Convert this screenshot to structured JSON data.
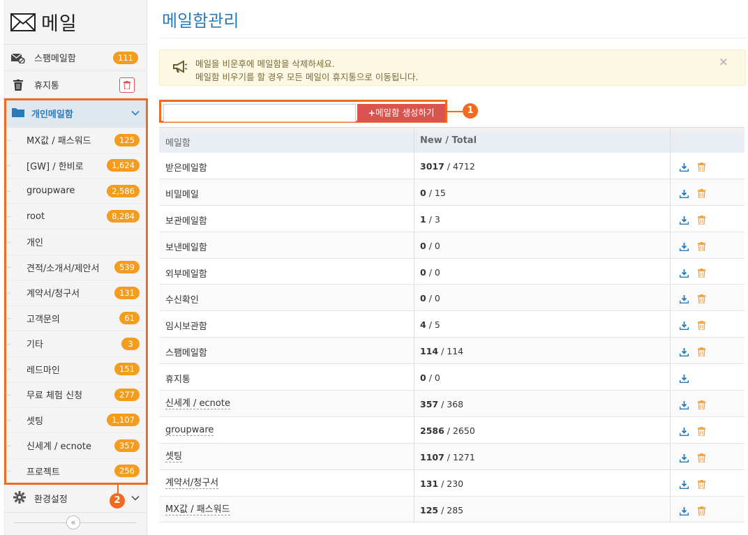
{
  "app": {
    "title": "메일"
  },
  "sidebar": {
    "top_items": [
      {
        "label": "스팸메일함",
        "badge": "111",
        "icon": "spam-mail-icon"
      },
      {
        "label": "휴지통",
        "icon": "trash-icon"
      }
    ],
    "folder_group": {
      "label": "개인메일함",
      "icon": "folder-icon"
    },
    "folders": [
      {
        "label": "MX값 / 패스워드",
        "badge": "125"
      },
      {
        "label": "[GW] / 한비로",
        "badge": "1,624"
      },
      {
        "label": "groupware",
        "badge": "2,586"
      },
      {
        "label": "root",
        "badge": "8,284"
      },
      {
        "label": "개인",
        "badge": ""
      },
      {
        "label": "견적/소개서/제안서",
        "badge": "539"
      },
      {
        "label": "계약서/청구서",
        "badge": "131"
      },
      {
        "label": "고객문의",
        "badge": "61"
      },
      {
        "label": "기타",
        "badge": "3"
      },
      {
        "label": "레드마인",
        "badge": "151"
      },
      {
        "label": "무료 체험 신청",
        "badge": "277"
      },
      {
        "label": "셋팅",
        "badge": "1,107"
      },
      {
        "label": "신세계 / ecnote",
        "badge": "357"
      },
      {
        "label": "프로젝트",
        "badge": "256"
      }
    ],
    "settings": {
      "label": "환경설정",
      "icon": "gear-icon"
    },
    "collapse": "«"
  },
  "markers": {
    "one": "1",
    "two": "2"
  },
  "main": {
    "title": "메일함관리",
    "notice": {
      "line1": "메일을 비운후에 메일함을 삭제하세요.",
      "line2": "메일함 비우기를 할 경우 모든 메일이 휴지통으로 이동됩니다.",
      "close": "×"
    },
    "create": {
      "input_value": "",
      "button_label": "메일함 생성하기",
      "button_icon": "+"
    },
    "table": {
      "headers": {
        "name": "메일함",
        "count": "New / Total"
      },
      "rows": [
        {
          "name": "받은메일함",
          "new": "3017",
          "total": "/ 4712",
          "deletable": true,
          "link": false
        },
        {
          "name": "비밀메일",
          "new": "0",
          "total": "/ 15",
          "deletable": true,
          "link": false
        },
        {
          "name": "보관메일함",
          "new": "1",
          "total": "/ 3",
          "deletable": true,
          "link": false
        },
        {
          "name": "보낸메일함",
          "new": "0",
          "total": "/ 0",
          "deletable": true,
          "link": false
        },
        {
          "name": "외부메일함",
          "new": "0",
          "total": "/ 0",
          "deletable": true,
          "link": false
        },
        {
          "name": "수신확인",
          "new": "0",
          "total": "/ 0",
          "deletable": true,
          "link": false
        },
        {
          "name": "임시보관함",
          "new": "4",
          "total": "/ 5",
          "deletable": true,
          "link": false
        },
        {
          "name": "스팸메일함",
          "new": "114",
          "total": "/ 114",
          "deletable": true,
          "link": false
        },
        {
          "name": "휴지통",
          "new": "0",
          "total": "/ 0",
          "deletable": false,
          "link": false
        },
        {
          "name": "신세계 / ecnote",
          "new": "357",
          "total": "/ 368",
          "deletable": true,
          "link": true
        },
        {
          "name": "groupware",
          "new": "2586",
          "total": "/ 2650",
          "deletable": true,
          "link": true
        },
        {
          "name": "셋팅",
          "new": "1107",
          "total": "/ 1271",
          "deletable": true,
          "link": true
        },
        {
          "name": "계약서/청구서",
          "new": "131",
          "total": "/ 230",
          "deletable": true,
          "link": true
        },
        {
          "name": "MX값 / 패스워드",
          "new": "125",
          "total": "/ 285",
          "deletable": true,
          "link": true
        }
      ]
    }
  },
  "colors": {
    "accent_blue": "#2a7ab8",
    "badge_orange": "#f39c1e",
    "highlight_orange": "#f26a21",
    "button_red": "#d9534f"
  }
}
